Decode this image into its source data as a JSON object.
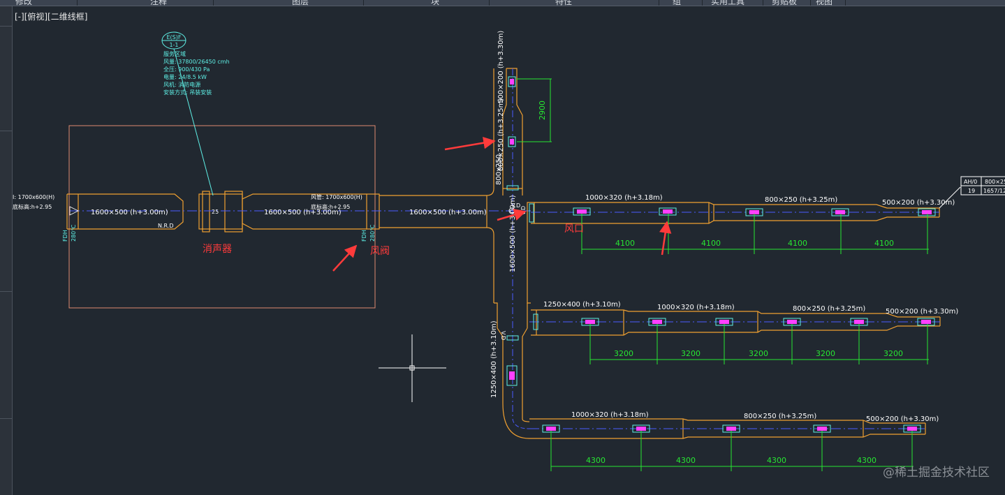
{
  "ribbon_tabs": [
    "修改",
    "注释",
    "图层",
    "块",
    "特性",
    "组",
    "实用工具",
    "剪贴板",
    "视图"
  ],
  "viewport_label": "[-][俯视][二维线框]",
  "watermark": "@稀土掘金技术社区",
  "colors": {
    "background": "#212830",
    "duct_outline": "#f0a030",
    "room_outline": "#e08a70",
    "centerline": "#4a5cff",
    "dimension": "#27e632",
    "equipment_tag": "#5ff0e6",
    "annotation_red": "#ff3b3b",
    "diffuser": "#ff40ff"
  },
  "equipment_tag": {
    "id": "E(S)F",
    "sub": "1-1",
    "lines": [
      "服务区域",
      "风量: 37800/26450 cmh",
      "全压: 900/430 Pa",
      "电量: 24/8.5 kW",
      "风机: 消防电源",
      "安装方式: 吊装安装"
    ]
  },
  "main_duct": {
    "inlet_label": "I: 1700x600(H)",
    "inlet_elev": "底标高:h+2.95",
    "seg1": "1600×500 (h+3.00m)",
    "nrd": "N.R.D",
    "seg2": "1600×500 (h+3.00m)",
    "outlet_label": "风管: 1700x600(H)",
    "outlet_elev": "底标高:h+2.95",
    "seg3": "1600×500 (h+3.00m)",
    "fdh_left": "FDH",
    "fdh_left_temp": "280℃",
    "fdh_right": "FDH",
    "fdh_right_temp": "280℃",
    "silencer_mark": "25"
  },
  "riser_up": {
    "label_top": "500×200 (h+3.30m)",
    "label_mid": "800×250 (h+3.25m)",
    "label_bottom": "800x250",
    "dim": "2900"
  },
  "vertical_main": {
    "label_upper": "1600×500 (h+3.00m)",
    "label_lower": "1250×400 (h+3.10m)",
    "vd1": "V.D",
    "vd2": "V.D",
    "vd3": "V.D"
  },
  "branch1": {
    "seg_a": "1000×320 (h+3.18m)",
    "seg_b": "800×250 (h+3.25m)",
    "seg_c": "500×200 (h+3.30m)",
    "dims": [
      "4100",
      "4100",
      "4100",
      "4100"
    ]
  },
  "branch2": {
    "seg_0": "1250×400 (h+3.10m)",
    "seg_a": "1000×320 (h+3.18m)",
    "seg_b": "800×250 (h+3.25m)",
    "seg_c": "500×200 (h+3.30m)",
    "dims": [
      "3200",
      "3200",
      "3200",
      "3200",
      "3200"
    ]
  },
  "branch3": {
    "seg_a": "1000×320 (h+3.18m)",
    "seg_b": "800×250 (h+3.25m)",
    "seg_c": "500×200 (h+3.30m)",
    "dims": [
      "4300",
      "4300",
      "4300",
      "4300"
    ]
  },
  "table": {
    "headers": [
      "AH/0",
      "800×25"
    ],
    "row": [
      "19",
      "1657/12"
    ]
  },
  "annotations": {
    "silencer": "消声器",
    "damper": "风阀",
    "diffuser": "风口"
  }
}
